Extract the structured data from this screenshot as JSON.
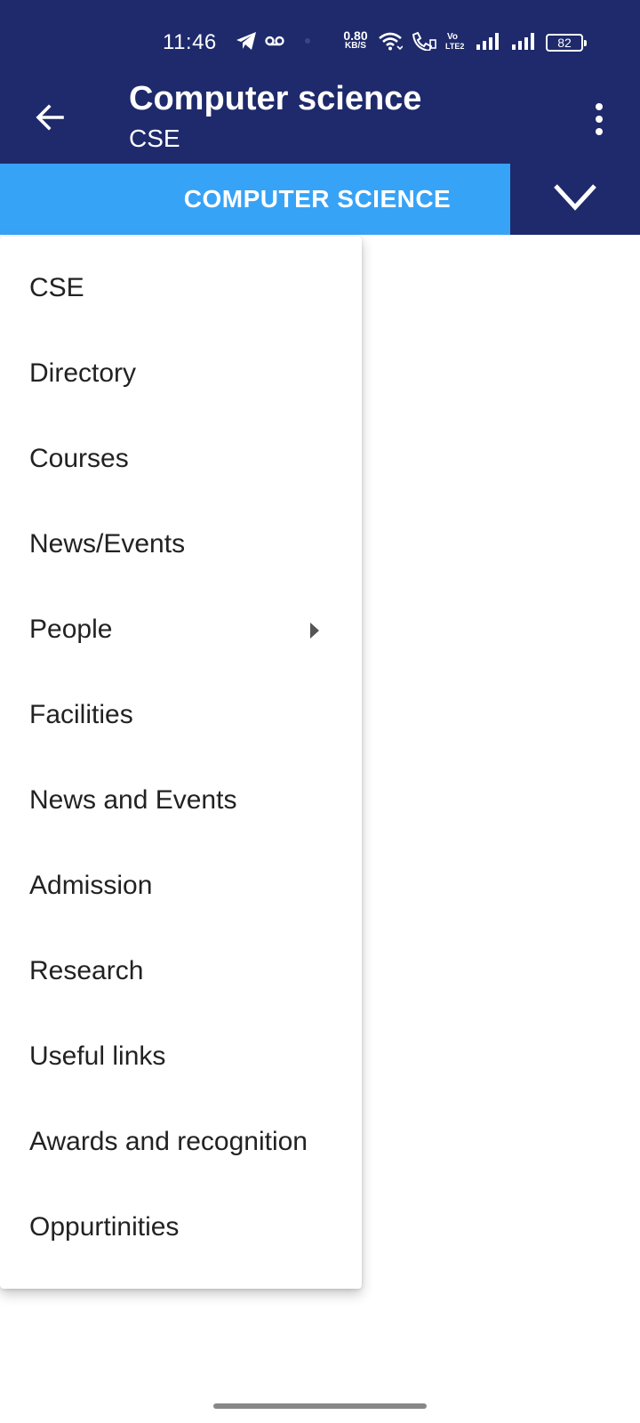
{
  "status_bar": {
    "time": "11:46",
    "network_speed_value": "0.80",
    "network_speed_unit": "KB/S",
    "battery": "82",
    "icons": [
      "telegram-icon",
      "voicemail-icon",
      "dot-icon",
      "wifi-icon",
      "wifi-calling-icon",
      "volte-icon",
      "signal-icon",
      "signal-icon"
    ]
  },
  "app_bar": {
    "title": "Computer science",
    "subtitle": "CSE",
    "back_icon": "arrow-back-icon",
    "more_icon": "more-vert-icon"
  },
  "section_selector": {
    "label": "COMPUTER SCIENCE",
    "toggle_icon": "chevron-down-icon"
  },
  "menu": {
    "items": [
      {
        "label": "CSE",
        "has_submenu": false
      },
      {
        "label": "Directory",
        "has_submenu": false
      },
      {
        "label": "Courses",
        "has_submenu": false
      },
      {
        "label": "News/Events",
        "has_submenu": false
      },
      {
        "label": "People",
        "has_submenu": true
      },
      {
        "label": "Facilities",
        "has_submenu": false
      },
      {
        "label": "News and Events",
        "has_submenu": false
      },
      {
        "label": "Admission",
        "has_submenu": false
      },
      {
        "label": "Research",
        "has_submenu": false
      },
      {
        "label": "Useful links",
        "has_submenu": false
      },
      {
        "label": "Awards and recognition",
        "has_submenu": false
      },
      {
        "label": "Oppurtinities",
        "has_submenu": false
      }
    ]
  },
  "colors": {
    "primary_dark": "#1e2a6b",
    "accent_blue": "#37a3f7",
    "text": "#222222"
  }
}
